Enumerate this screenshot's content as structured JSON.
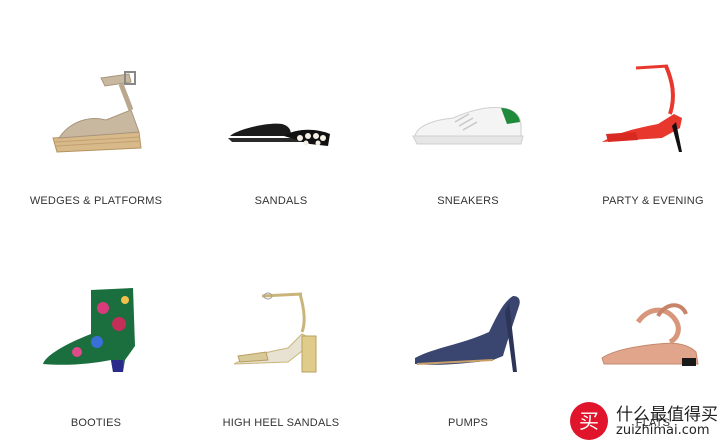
{
  "categories": [
    {
      "label": "WEDGES & PLATFORMS",
      "icon": "wedge-platform-shoe-icon"
    },
    {
      "label": "SANDALS",
      "icon": "slide-sandal-icon"
    },
    {
      "label": "SNEAKERS",
      "icon": "sneaker-icon"
    },
    {
      "label": "PARTY & EVENING",
      "icon": "red-heel-sandal-icon"
    },
    {
      "label": "BOOTIES",
      "icon": "floral-bootie-icon"
    },
    {
      "label": "HIGH HEEL SANDALS",
      "icon": "metallic-heel-sandal-icon"
    },
    {
      "label": "PUMPS",
      "icon": "pump-icon"
    },
    {
      "label": "FLATS",
      "icon": "flat-shoe-icon"
    }
  ],
  "watermark": {
    "badge": "买",
    "chinese": "什么最值得买",
    "domain": "zuizhimai.com"
  },
  "colors": {
    "accent_red": "#e0142a",
    "label_text": "#333333"
  }
}
